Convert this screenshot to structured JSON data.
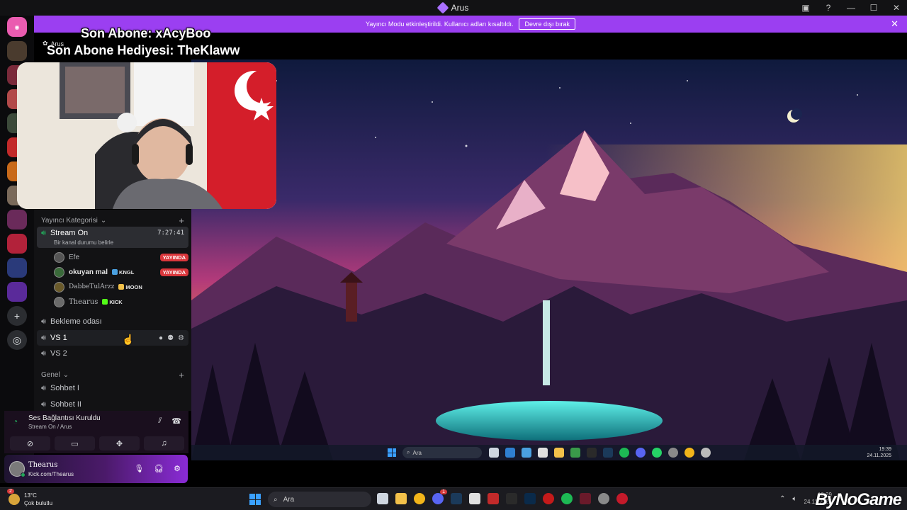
{
  "window": {
    "title": "Arus"
  },
  "banner": {
    "text": "Yayıncı Modu etkinleştirildi. Kullanıcı adları kısaltıldı.",
    "button": "Devre dışı bırak"
  },
  "rail": {
    "servers": [
      "discord-home",
      "server-1",
      "server-2",
      "server-3",
      "server-4",
      "server-5",
      "server-6",
      "server-7",
      "server-8",
      "server-9",
      "server-10"
    ]
  },
  "server_name": "Arus",
  "overlay": {
    "last_sub": "Son Abone: xAcyBoo",
    "last_gift": "Son Abone Hediyesi: TheKlaww"
  },
  "sidebar": {
    "category1": "Yayıncı Kategorisi",
    "stream_channel": {
      "name": "Stream On",
      "timer": "7:27:41",
      "status": "Bir kanal durumu belirle"
    },
    "members": [
      {
        "name": "Efe",
        "badge": "YAYINDA"
      },
      {
        "name": "okuyan mal",
        "tag": "KNGL",
        "badge": "YAYINDA"
      },
      {
        "name": "DabbeTulArzz",
        "tag": "MOON"
      },
      {
        "name": "Thearus",
        "tag": "KICK"
      }
    ],
    "channels": [
      "Bekleme odası",
      "VS 1",
      "VS 2"
    ],
    "category2": "Genel",
    "general_channels": [
      "Sohbet I",
      "Sohbet II"
    ]
  },
  "voice": {
    "status": "Ses Bağlantısı Kuruldu",
    "location": "Stream On / Arus"
  },
  "userpanel": {
    "name": "Thearus",
    "sub": "Kick.com/Thearus"
  },
  "inner_taskbar": {
    "search": "Ara",
    "time": "19:39",
    "date": "24.11.2025"
  },
  "taskbar": {
    "temp": "13°C",
    "weather": "Çok bulutlu",
    "search": "Ara",
    "badge": "1",
    "weather_badge": "2",
    "time": "19:39",
    "date": "24.11.2025"
  },
  "watermark": "ByNoGame",
  "colors": {
    "accent": "#9b3ff1",
    "live": "#da373c",
    "online": "#23a55a",
    "rail": "#0b0b0d"
  }
}
